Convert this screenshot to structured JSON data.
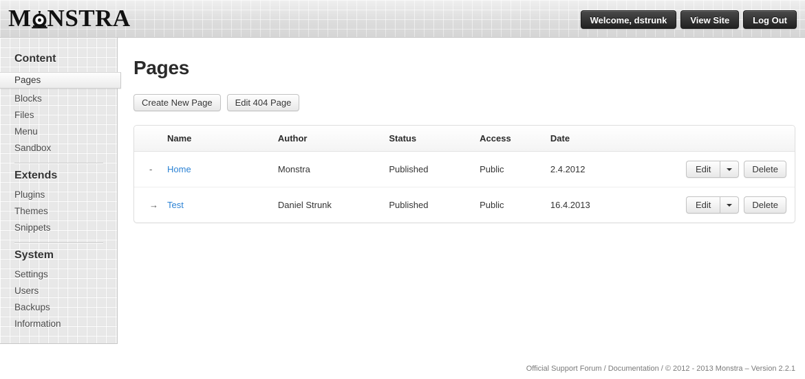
{
  "header": {
    "logo": {
      "text_before": "M",
      "eye_letter": "O",
      "text_after": "NSTRA",
      "full": "MONSTRA"
    },
    "buttons": [
      {
        "label": "Welcome, dstrunk",
        "name": "welcome-button"
      },
      {
        "label": "View Site",
        "name": "view-site-button"
      },
      {
        "label": "Log Out",
        "name": "log-out-button"
      }
    ]
  },
  "sidebar": {
    "groups": [
      {
        "title": "Content",
        "items": [
          {
            "label": "Pages",
            "active": true
          },
          {
            "label": "Blocks",
            "active": false
          },
          {
            "label": "Files",
            "active": false
          },
          {
            "label": "Menu",
            "active": false
          },
          {
            "label": "Sandbox",
            "active": false
          }
        ]
      },
      {
        "title": "Extends",
        "items": [
          {
            "label": "Plugins",
            "active": false
          },
          {
            "label": "Themes",
            "active": false
          },
          {
            "label": "Snippets",
            "active": false
          }
        ]
      },
      {
        "title": "System",
        "items": [
          {
            "label": "Settings",
            "active": false
          },
          {
            "label": "Users",
            "active": false
          },
          {
            "label": "Backups",
            "active": false
          },
          {
            "label": "Information",
            "active": false
          }
        ]
      }
    ]
  },
  "main": {
    "title": "Pages",
    "toolbar": [
      {
        "label": "Create New Page",
        "name": "create-new-page-button"
      },
      {
        "label": "Edit 404 Page",
        "name": "edit-404-page-button"
      }
    ],
    "table": {
      "columns": [
        "Name",
        "Author",
        "Status",
        "Access",
        "Date"
      ],
      "rows": [
        {
          "prefix": "-",
          "indent": false,
          "name": "Home",
          "author": "Monstra",
          "status": "Published",
          "access": "Public",
          "date": "2.4.2012",
          "edit_label": "Edit",
          "delete_label": "Delete"
        },
        {
          "prefix": "→",
          "indent": true,
          "name": "Test",
          "author": "Daniel Strunk",
          "status": "Published",
          "access": "Public",
          "date": "16.4.2013",
          "edit_label": "Edit",
          "delete_label": "Delete"
        }
      ]
    }
  },
  "footer": {
    "support_forum": "Official Support Forum",
    "sep1": " / ",
    "documentation": "Documentation",
    "sep2": " / ",
    "copyright": "© 2012 - 2013 Monstra – Version 2.2.1"
  },
  "colors": {
    "link": "#2b82d4",
    "header_button_bg": "#2e2e2e",
    "page_bg": "#e8e8e8"
  }
}
